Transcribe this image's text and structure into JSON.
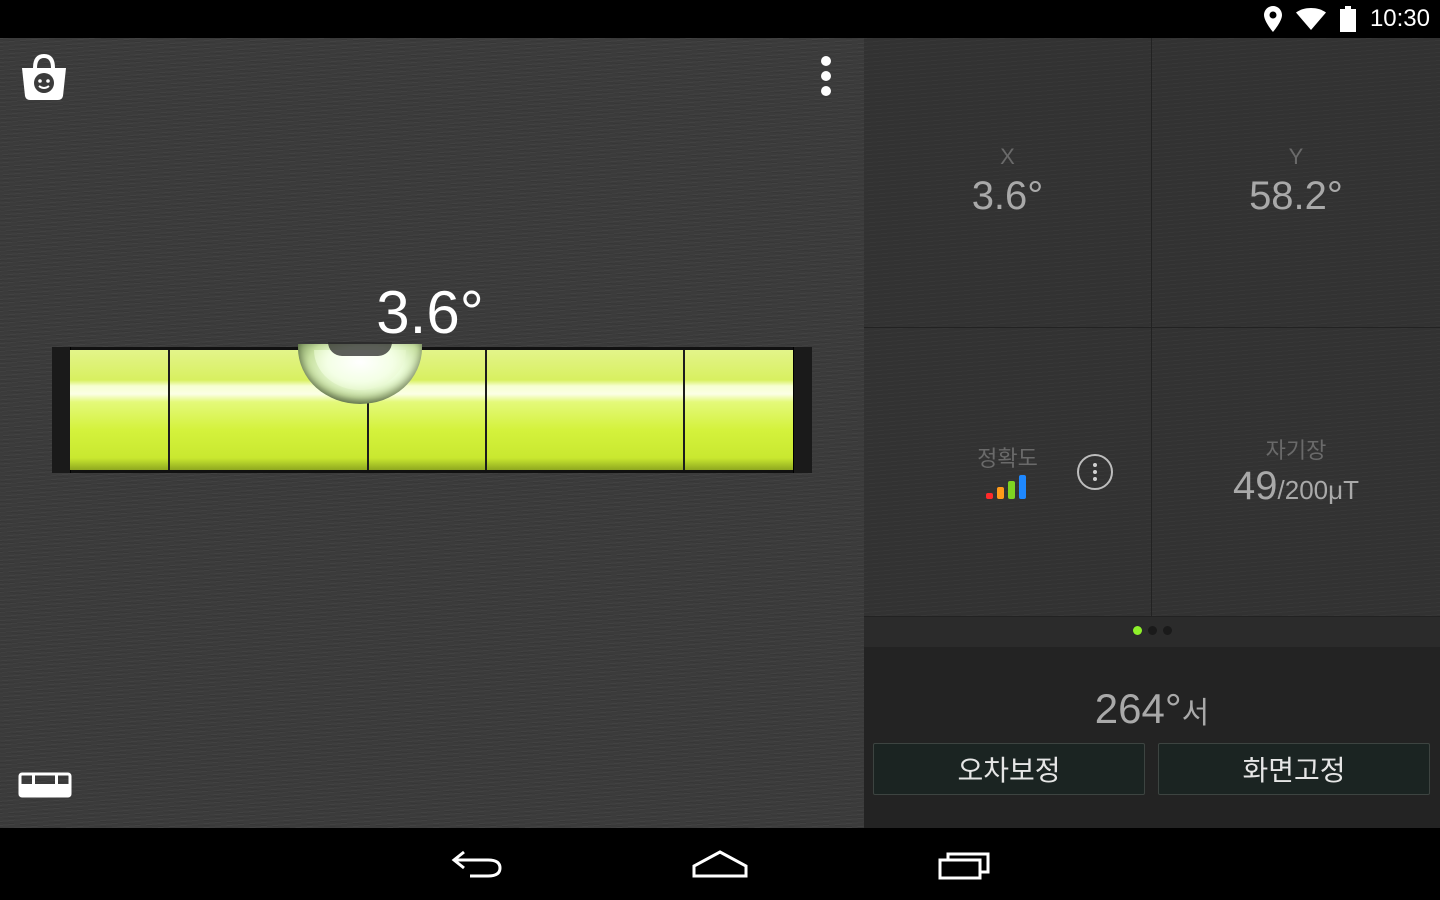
{
  "status_bar": {
    "time": "10:30",
    "icons": [
      "location-icon",
      "wifi-icon",
      "battery-icon"
    ]
  },
  "toolbar": {
    "shop_icon": "shopping-bag-icon",
    "menu_icon": "more-vert-icon",
    "ruler_icon": "ruler-icon"
  },
  "level": {
    "angle": "3.6°"
  },
  "readings": {
    "x_label": "X",
    "x_value": "3.6°",
    "y_label": "Y",
    "y_value": "58.2°",
    "accuracy_label": "정확도",
    "accuracy_bar_colors": [
      "#ff2a2a",
      "#ff9a1a",
      "#7ed321",
      "#1e88ff"
    ],
    "magnetic_label": "자기장",
    "magnetic_value": "49",
    "magnetic_unit": "/200μT"
  },
  "pager": {
    "pages": 3,
    "active_index": 0
  },
  "compass": {
    "heading_value": "264°",
    "heading_direction": "서"
  },
  "buttons": {
    "calibrate_label": "오차보정",
    "lock_label": "화면고정"
  },
  "nav": {
    "back_icon": "back-icon",
    "home_icon": "home-icon",
    "recents_icon": "recents-icon"
  },
  "colors": {
    "accent": "#8ef02a",
    "liquid": "#d4f23c"
  }
}
